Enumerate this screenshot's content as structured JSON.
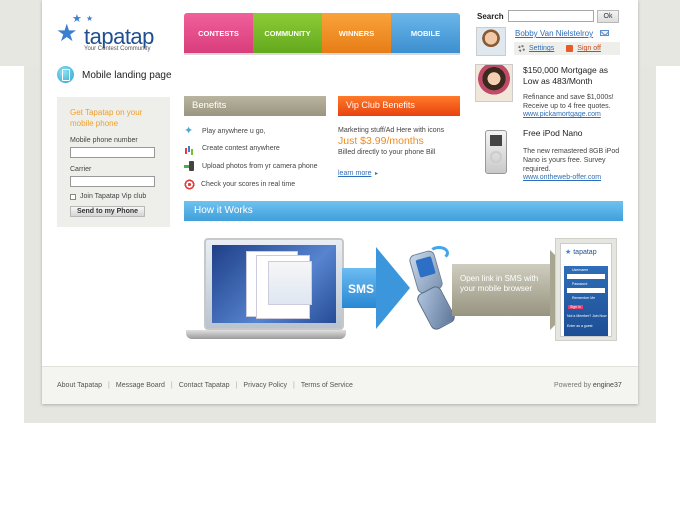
{
  "logo": {
    "name": "tapatap",
    "tagline": "Your Contest Community"
  },
  "nav": {
    "contests": "CONTESTS",
    "community": "COMMUNITY",
    "winners": "WINNERS",
    "mobile": "MOBILE"
  },
  "search": {
    "label": "Search",
    "value": "",
    "button": "Ok"
  },
  "user": {
    "name": "Bobby Van Nielstelroy",
    "settings": "Settings",
    "signoff": "Sign off"
  },
  "page": {
    "title": "Mobile landing page"
  },
  "left_panel": {
    "title": "Get Tapatap on your mobile phone",
    "phone_label": "Mobile phone number",
    "phone_value": "",
    "carrier_label": "Carrier",
    "carrier_value": "",
    "vip_checkbox": "Join Tapatap Vip club",
    "send_button": "Send to my Phone"
  },
  "benefits": {
    "title": "Benefits",
    "items": [
      {
        "icon": "star-icon",
        "text": "Play anywhere u go,"
      },
      {
        "icon": "chart-icon",
        "text": "Create contest anywhere"
      },
      {
        "icon": "phone-upload-icon",
        "text": "Upload photos from yr camera phone"
      },
      {
        "icon": "target-icon",
        "text": "Check your scores in real time"
      }
    ]
  },
  "vip": {
    "title": "Vip Club Benefits",
    "line1": "Marketing stuff/Ad Here with icons",
    "price": "Just $3.99/months",
    "line2": "Billed directly to your phone Bill",
    "more": "learn more"
  },
  "how_it_works": {
    "title": "How it Works",
    "sms_label": "SMS",
    "link_label": "Open link in SMS with your mobile browser",
    "mobile_preview": {
      "logo": "tapatap",
      "username_label": "Username",
      "password_label": "Password",
      "remember_label": "Remember Me",
      "signin_label": "Sign in",
      "member_text": "Not a Member? Join Now",
      "guest_text": "Enter as a guest"
    }
  },
  "ads": [
    {
      "title": "$150,000 Mortgage as Low as 483/Month",
      "text": "Refinance and save $1,000s! Receive up to 4 free quotes.",
      "link": "www.pickamortgage.com"
    },
    {
      "title": "Free iPod Nano",
      "text": "The new remastered 8GB iPod Nano is yours free. Survey required.",
      "link": "www.ontheweb-offer.com"
    }
  ],
  "footer": {
    "links": [
      "About Tapatap",
      "Message Board",
      "Contact Tapatap",
      "Privacy Policy",
      "Terms of Service"
    ],
    "powered_by": "Powered by",
    "engine": "engine37"
  },
  "colors": {
    "contests": "#e34b88",
    "community": "#75b82a",
    "winners": "#f09027",
    "mobile": "#54a2de",
    "vip": "#f05a1a",
    "how_it_works": "#56b0e6",
    "link": "#2f6eb8"
  }
}
